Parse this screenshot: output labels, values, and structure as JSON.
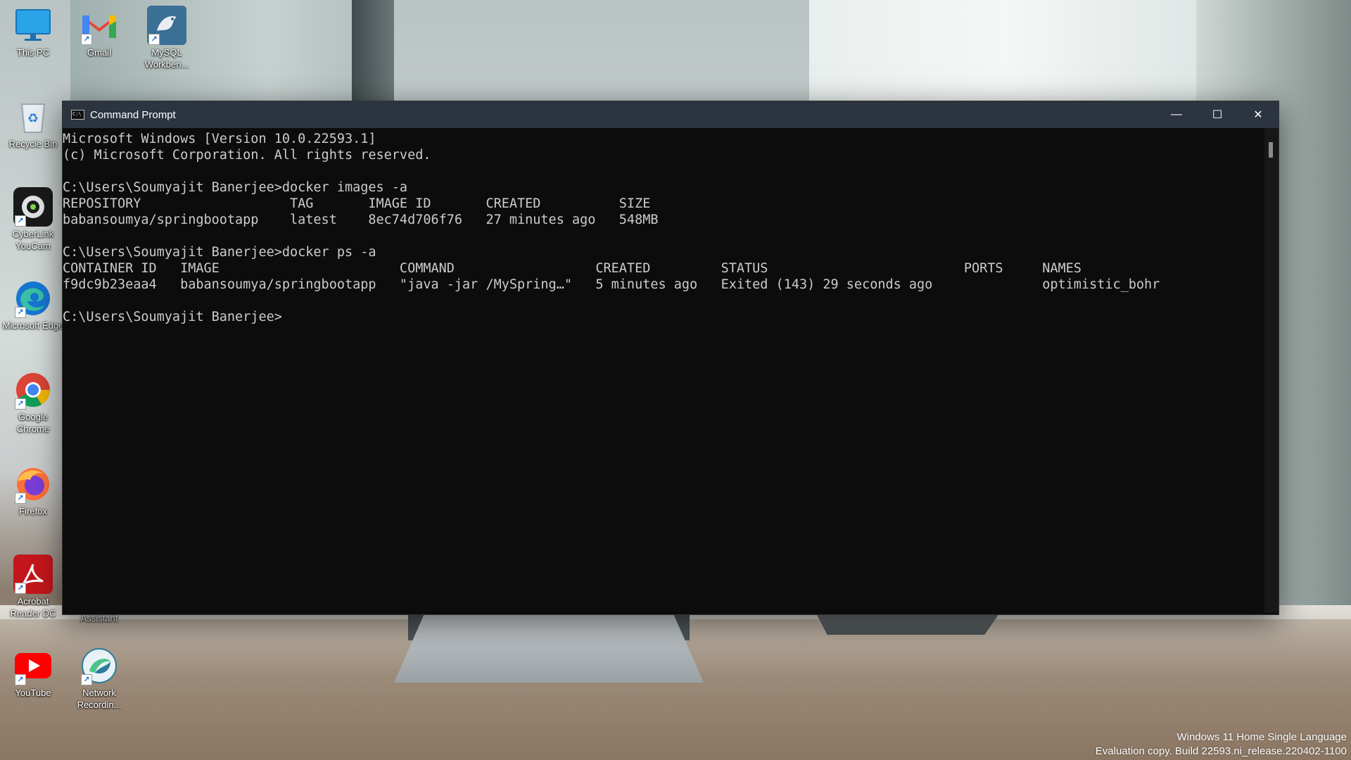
{
  "desktop": {
    "icons": [
      {
        "label": "This PC",
        "icon": "monitor-icon"
      },
      {
        "label": "Gmail",
        "icon": "gmail-icon"
      },
      {
        "label": "MySQL Workben...",
        "icon": "mysql-workbench-icon"
      },
      {
        "label": "Recycle Bin",
        "icon": "recycle-bin-icon"
      },
      {
        "label": "CyberLink YouCam",
        "icon": "youcam-icon"
      },
      {
        "label": "Microsoft Edge",
        "icon": "edge-icon"
      },
      {
        "label": "Google Chrome",
        "icon": "chrome-icon"
      },
      {
        "label": "Firefox",
        "icon": "firefox-icon"
      },
      {
        "label": "Acrobat Reader DC",
        "icon": "acrobat-icon"
      },
      {
        "label": "Assistant",
        "icon": "assistant-icon"
      },
      {
        "label": "YouTube",
        "icon": "youtube-icon"
      },
      {
        "label": "Network Recordin...",
        "icon": "network-recorder-icon"
      }
    ]
  },
  "window": {
    "title": "Command Prompt",
    "app_icon_text": "C:\\",
    "minimize": "—",
    "maximize": "☐",
    "close": "✕"
  },
  "console": {
    "lines": [
      "Microsoft Windows [Version 10.0.22593.1]",
      "(c) Microsoft Corporation. All rights reserved.",
      "",
      "C:\\Users\\Soumyajit Banerjee>docker images -a",
      "REPOSITORY                   TAG       IMAGE ID       CREATED          SIZE",
      "babansoumya/springbootapp    latest    8ec74d706f76   27 minutes ago   548MB",
      "",
      "C:\\Users\\Soumyajit Banerjee>docker ps -a",
      "CONTAINER ID   IMAGE                       COMMAND                  CREATED         STATUS                         PORTS     NAMES",
      "f9dc9b23eaa4   babansoumya/springbootapp   \"java -jar /MySpring…\"   5 minutes ago   Exited (143) 29 seconds ago              optimistic_bohr",
      "",
      "C:\\Users\\Soumyajit Banerjee>"
    ]
  },
  "watermark": {
    "line1": "Windows 11 Home Single Language",
    "line2": "Evaluation copy. Build 22593.ni_release.220402-1100"
  }
}
